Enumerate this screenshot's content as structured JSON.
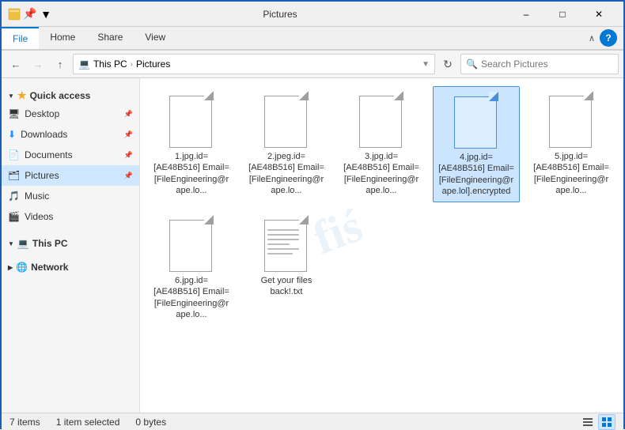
{
  "titlebar": {
    "title": "Pictures",
    "minimize": "–",
    "maximize": "□",
    "close": "✕",
    "quick_access_icon": "⚡",
    "folder_icon": "📁",
    "pin_icon": "📌"
  },
  "ribbon": {
    "tabs": [
      "File",
      "Home",
      "Share",
      "View"
    ],
    "active_tab": "File",
    "expand_icon": "∧",
    "help_label": "?"
  },
  "addressbar": {
    "back_disabled": false,
    "forward_disabled": true,
    "up": "↑",
    "path_parts": [
      "This PC",
      "Pictures"
    ],
    "search_placeholder": "Search Pictures"
  },
  "sidebar": {
    "quick_access_label": "Quick access",
    "items": [
      {
        "label": "Desktop",
        "icon": "🖥",
        "pinned": true
      },
      {
        "label": "Downloads",
        "icon": "⬇",
        "pinned": true
      },
      {
        "label": "Documents",
        "icon": "📄",
        "pinned": true
      },
      {
        "label": "Pictures",
        "icon": "🗂",
        "pinned": true,
        "active": true
      },
      {
        "label": "Music",
        "icon": "🎵",
        "pinned": false
      },
      {
        "label": "Videos",
        "icon": "🎬",
        "pinned": false
      }
    ],
    "this_pc_label": "This PC",
    "network_label": "Network"
  },
  "files": [
    {
      "name": "1.jpg.id=[AE48B516]\nEmail=[FileEngineering@rape.lo...",
      "type": "doc",
      "selected": false
    },
    {
      "name": "2.jpeg.id=[AE48B516]\nEmail=[FileEngineering@rape.lo...",
      "type": "doc",
      "selected": false
    },
    {
      "name": "3.jpg.id=[AE48B516]\nEmail=[FileEngineering@rape.lo...",
      "type": "doc",
      "selected": false
    },
    {
      "name": "4.jpg.id=\n[AE48B516]\nEmail=\n[FileEngineering@rape.lol].encrypted",
      "type": "doc",
      "selected": true
    },
    {
      "name": "5.jpg.id=[AE48B516]\nEmail=[FileEngineering@rape.lo...",
      "type": "doc",
      "selected": false
    },
    {
      "name": "6.jpg.id=[AE48B516]\nEmail=[FileEngineering@rape.lo...",
      "type": "doc",
      "selected": false
    },
    {
      "name": "Get your files back!.txt",
      "type": "txt",
      "selected": false
    }
  ],
  "statusbar": {
    "item_count": "7 items",
    "selected": "1 item selected",
    "size": "0 bytes"
  }
}
